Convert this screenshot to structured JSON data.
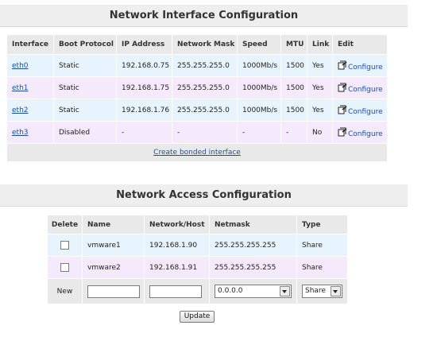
{
  "interface_section": {
    "title": "Network Interface Configuration",
    "columns": [
      "Interface",
      "Boot Protocol",
      "IP Address",
      "Network Mask",
      "Speed",
      "MTU",
      "Link",
      "Edit"
    ],
    "rows": [
      {
        "interface": "eth0",
        "boot_protocol": "Static",
        "ip": "192.168.0.75",
        "mask": "255.255.255.0",
        "speed": "1000Mb/s",
        "mtu": "1500",
        "link": "Yes",
        "edit_label": "Configure"
      },
      {
        "interface": "eth1",
        "boot_protocol": "Static",
        "ip": "192.168.1.75",
        "mask": "255.255.255.0",
        "speed": "1000Mb/s",
        "mtu": "1500",
        "link": "Yes",
        "edit_label": "Configure"
      },
      {
        "interface": "eth2",
        "boot_protocol": "Static",
        "ip": "192.168.1.76",
        "mask": "255.255.255.0",
        "speed": "1000Mb/s",
        "mtu": "1500",
        "link": "Yes",
        "edit_label": "Configure"
      },
      {
        "interface": "eth3",
        "boot_protocol": "Disabled",
        "ip": "-",
        "mask": "-",
        "speed": "-",
        "mtu": "-",
        "link": "No",
        "edit_label": "Configure"
      }
    ],
    "bond_link": "Create bonded interface"
  },
  "access_section": {
    "title": "Network Access Configuration",
    "columns": [
      "Delete",
      "Name",
      "Network/Host",
      "Netmask",
      "Type"
    ],
    "rows": [
      {
        "name": "vmware1",
        "host": "192.168.1.90",
        "netmask": "255.255.255.255",
        "type": "Share"
      },
      {
        "name": "vmware2",
        "host": "192.168.1.91",
        "netmask": "255.255.255.255",
        "type": "Share"
      }
    ],
    "new_row": {
      "label": "New",
      "name_value": "",
      "host_value": "",
      "netmask_selected": "0.0.0.0",
      "type_selected": "Share"
    },
    "update_button": "Update"
  },
  "colors": {
    "header_bg": "#eeeeee",
    "row_blue": "#e8f4fd",
    "row_purple": "#f5eafc",
    "link": "#1a4fa0"
  },
  "icons": {
    "configure": "configure-icon",
    "dropdown": "chevron-down-icon"
  }
}
